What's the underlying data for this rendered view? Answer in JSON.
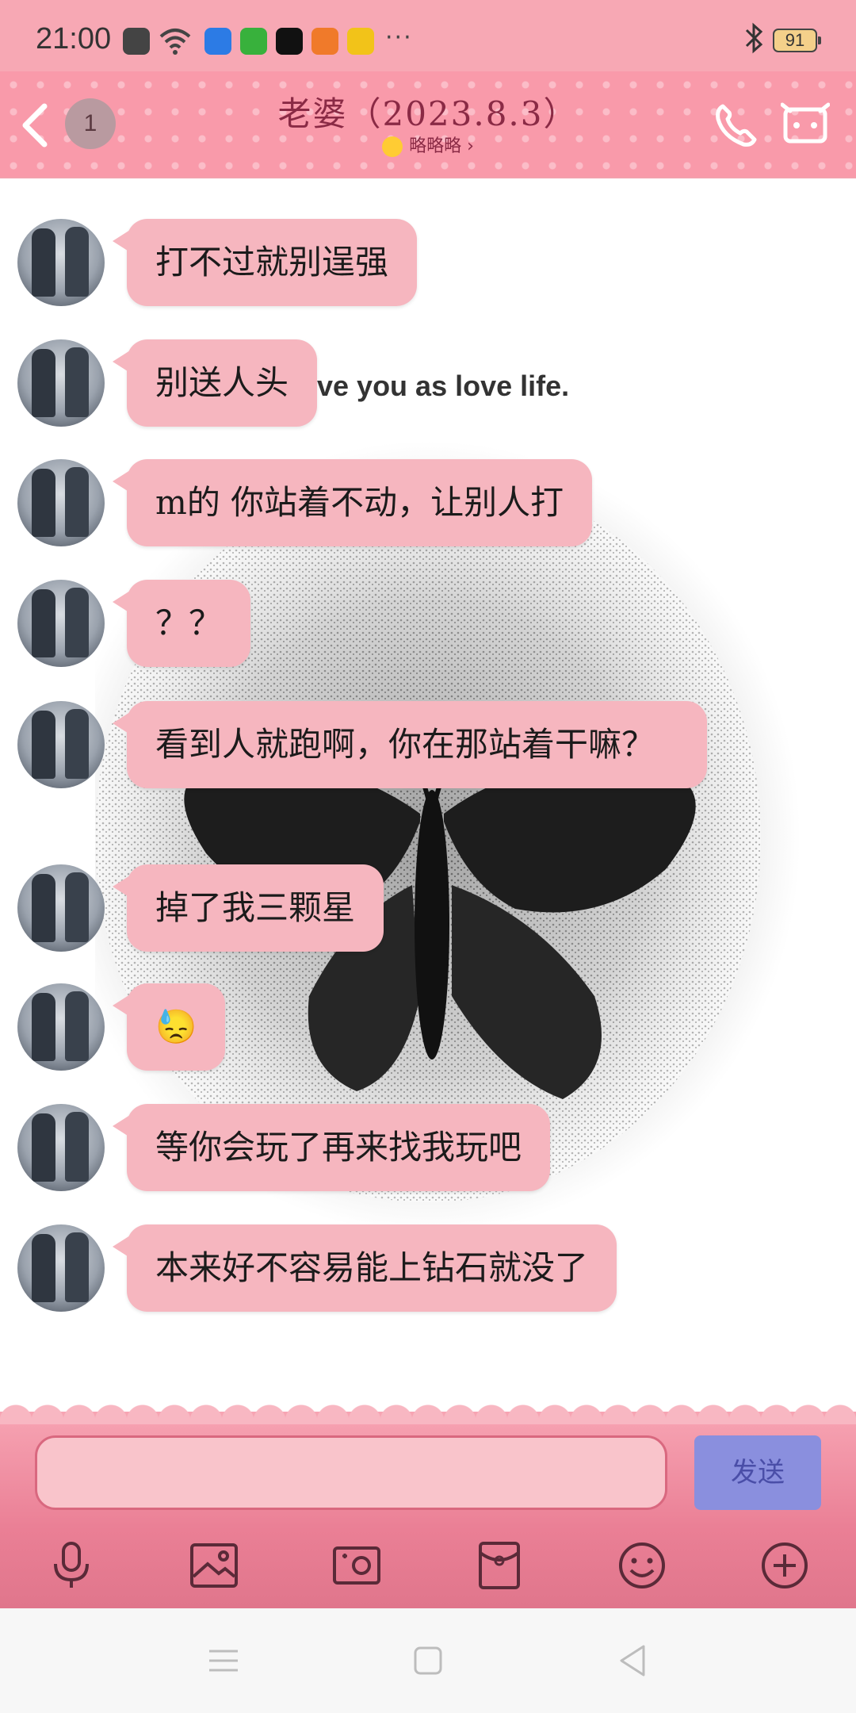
{
  "status_bar": {
    "time": "21:00",
    "battery": "91",
    "more": "···",
    "bluetooth_icon": "bluetooth-icon",
    "app_icon_colors": [
      "#444444",
      "#2c7be5",
      "#38b13c",
      "#111111",
      "#f07a2a",
      "#f2c319"
    ]
  },
  "header": {
    "unread_count": "1",
    "title": "老婆（2023.8.3）",
    "subtitle": "略略略",
    "subtitle_arrow": "›"
  },
  "background": {
    "text": "ve you as love life."
  },
  "messages": [
    {
      "sender": "other",
      "text": "打不过就别逞强"
    },
    {
      "sender": "other",
      "text": "别送人头"
    },
    {
      "sender": "other",
      "text": "m的 你站着不动，让别人打"
    },
    {
      "sender": "other",
      "text": "？？"
    },
    {
      "sender": "other",
      "text": "看到人就跑啊，你在那站着干嘛？"
    },
    {
      "sender": "other",
      "text": "掉了我三颗星"
    },
    {
      "sender": "other",
      "text": "😓"
    },
    {
      "sender": "other",
      "text": "等你会玩了再来找我玩吧"
    },
    {
      "sender": "other",
      "text": "本来好不容易能上钻石就没了"
    }
  ],
  "input": {
    "placeholder": "",
    "value": "",
    "send_label": "发送"
  },
  "toolbar": {
    "icons": [
      "microphone-icon",
      "image-icon",
      "camera-icon",
      "red-packet-icon",
      "emoji-icon",
      "plus-icon"
    ]
  },
  "colors": {
    "header_bg": "#f99aaa",
    "bubble_bg": "#f6b6bf",
    "input_area_bg": "#e0768c",
    "send_button_bg": "#8a8fde"
  }
}
